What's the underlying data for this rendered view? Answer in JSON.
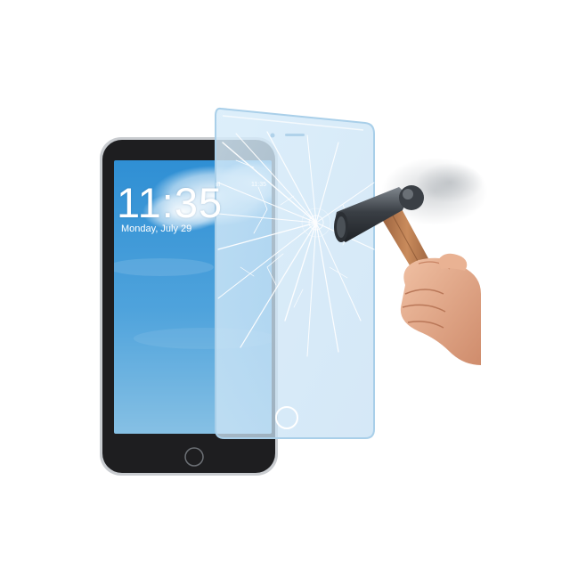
{
  "scene": {
    "subject": "tempered glass screen protector",
    "colors": {
      "background": "#ffffff",
      "tablet_bezel": "#1e1e20",
      "tablet_edge": "#c9ccd0",
      "sky_top": "#2f8fd4",
      "sky_bottom": "#6fb3de",
      "glass_tint": "#cfe6f7",
      "hammer_head": "#3b4046",
      "handle_wood": "#b5744a",
      "skin": "#e5a98a"
    }
  },
  "tablet": {
    "status_carrier": "ıll",
    "status_time": "11:35",
    "lock_time": "11:35",
    "lock_date": "Monday, July 29"
  }
}
